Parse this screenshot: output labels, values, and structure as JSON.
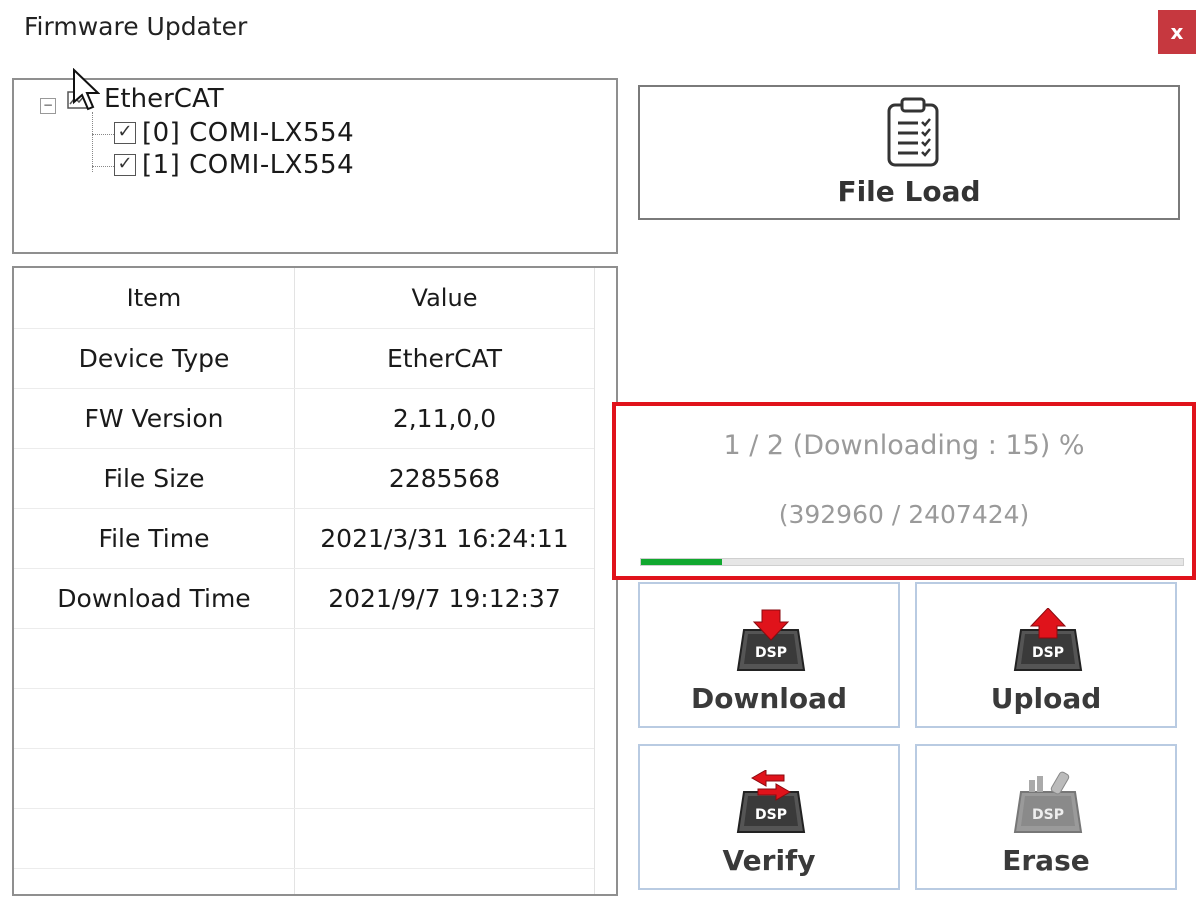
{
  "window": {
    "title": "Firmware Updater",
    "close_label": "x"
  },
  "tree": {
    "root_label": "EtherCAT",
    "expander": "−",
    "children": [
      {
        "label": "[0] COMI-LX554",
        "checked": true
      },
      {
        "label": "[1] COMI-LX554",
        "checked": true
      }
    ]
  },
  "table": {
    "headers": {
      "item": "Item",
      "value": "Value"
    },
    "rows": [
      {
        "item": "Device Type",
        "value": "EtherCAT"
      },
      {
        "item": "FW Version",
        "value": "2,11,0,0"
      },
      {
        "item": "File Size",
        "value": "2285568"
      },
      {
        "item": "File Time",
        "value": "2021/3/31 16:24:11"
      },
      {
        "item": "Download Time",
        "value": "2021/9/7 19:12:37"
      }
    ]
  },
  "buttons": {
    "file_load": "File Load",
    "download": "Download",
    "upload": "Upload",
    "verify": "Verify",
    "erase": "Erase",
    "icon_text": "DSP"
  },
  "progress": {
    "line1": "1 / 2 (Downloading : 15) %",
    "line2": "(392960 / 2407424)",
    "percent": 15,
    "bar_color": "#11a82f",
    "highlight_color": "#e0121b"
  },
  "icons": {
    "file_load": "clipboard-checklist-icon",
    "download": "dsp-download-icon",
    "upload": "dsp-upload-icon",
    "verify": "dsp-verify-icon",
    "erase": "dsp-erase-icon",
    "tree_root": "ethercat-network-icon",
    "cursor": "mouse-cursor-icon"
  }
}
